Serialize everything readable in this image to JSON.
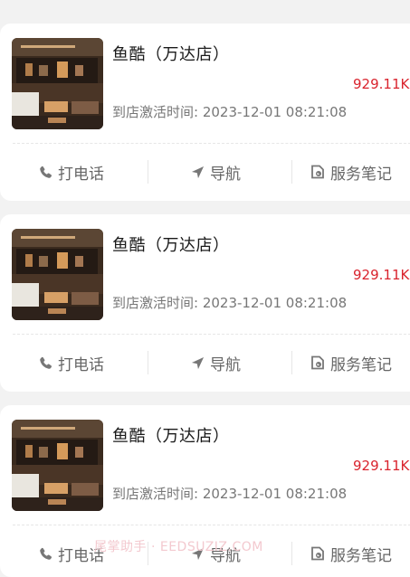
{
  "stores": [
    {
      "name": "鱼酷（万达店）",
      "distance": "929.11K",
      "activate_label": "到店激活时间:",
      "activate_time": "2023-12-01 08:21:08",
      "actions": {
        "call": "打电话",
        "navigate": "导航",
        "notes": "服务笔记"
      }
    },
    {
      "name": "鱼酷（万达店）",
      "distance": "929.11K",
      "activate_label": "到店激活时间:",
      "activate_time": "2023-12-01 08:21:08",
      "actions": {
        "call": "打电话",
        "navigate": "导航",
        "notes": "服务笔记"
      }
    },
    {
      "name": "鱼酷（万达店）",
      "distance": "929.11K",
      "activate_label": "到店激活时间:",
      "activate_time": "2023-12-01 08:21:08",
      "actions": {
        "call": "打电话",
        "navigate": "导航",
        "notes": "服务笔记"
      }
    }
  ],
  "icons": {
    "call": "phone-icon",
    "navigate": "navigation-arrow-icon",
    "notes": "service-notes-icon"
  },
  "colors": {
    "distance": "#d9232d",
    "watermark": "#f3c9cf"
  },
  "watermark": "尾掌助手 · EEDSUZIZ.COM"
}
